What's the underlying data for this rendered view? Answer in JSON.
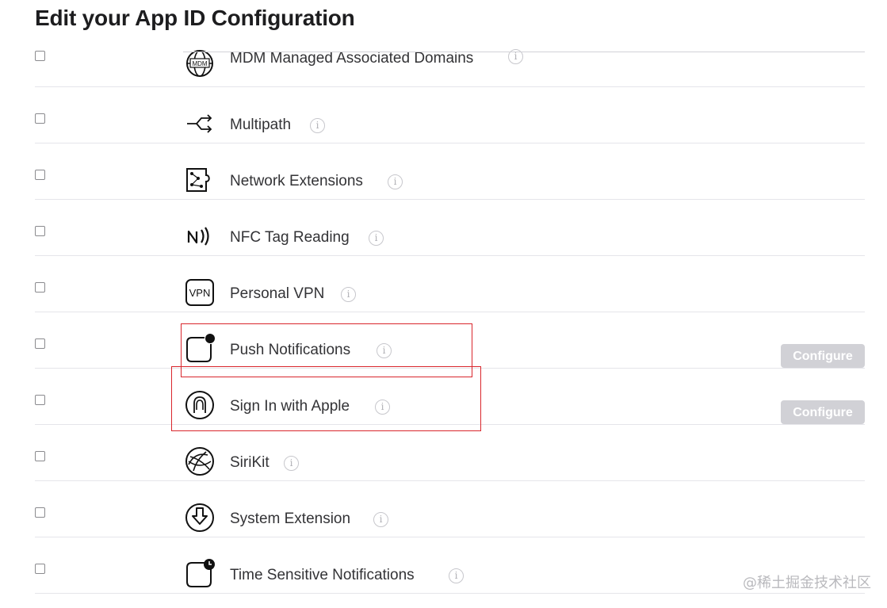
{
  "page": {
    "title": "Edit your App ID Configuration"
  },
  "info_glyph": "i",
  "capabilities": [
    {
      "label": "MDM Managed Associated Domains",
      "icon": "mdm-globe-icon",
      "checked": false,
      "configure": ""
    },
    {
      "label": "Multipath",
      "icon": "multipath-arrows-icon",
      "checked": false,
      "configure": ""
    },
    {
      "label": "Network Extensions",
      "icon": "network-extensions-icon",
      "checked": false,
      "configure": ""
    },
    {
      "label": "NFC Tag Reading",
      "icon": "nfc-icon",
      "checked": false,
      "configure": ""
    },
    {
      "label": "Personal VPN",
      "icon": "vpn-icon",
      "checked": false,
      "configure": ""
    },
    {
      "label": "Push Notifications",
      "icon": "push-notifications-icon",
      "checked": false,
      "configure": "Configure"
    },
    {
      "label": "Sign In with Apple",
      "icon": "sign-in-with-apple-icon",
      "checked": false,
      "configure": "Configure"
    },
    {
      "label": "SiriKit",
      "icon": "sirikit-icon",
      "checked": false,
      "configure": ""
    },
    {
      "label": "System Extension",
      "icon": "system-extension-icon",
      "checked": false,
      "configure": ""
    },
    {
      "label": "Time Sensitive Notifications",
      "icon": "time-sensitive-notifications-icon",
      "checked": false,
      "configure": ""
    }
  ],
  "mdm_badge": "MDM",
  "vpn_badge": "VPN",
  "watermark": "@稀土掘金技术社区",
  "colors": {
    "highlight": "#d9262c",
    "button_disabled": "#d1d1d6"
  }
}
